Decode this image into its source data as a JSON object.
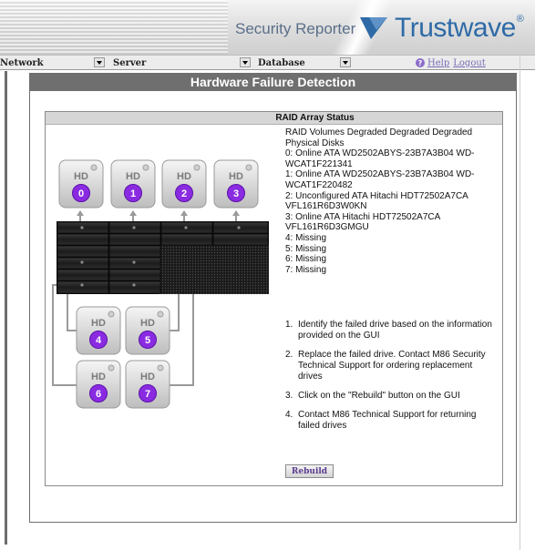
{
  "header": {
    "app_title": "Security Reporter",
    "logo_text": "Trustwave",
    "logo_mark": "®",
    "brand_color": "#2e6aa6"
  },
  "nav": {
    "network": "Network",
    "server": "Server",
    "database": "Database",
    "help": "Help",
    "logout": "Logout",
    "help_icon": "question-circle-icon"
  },
  "page": {
    "title": "Hardware Failure Detection"
  },
  "raid": {
    "panel_title": "RAID Array Status",
    "status_lines": [
      "RAID Volumes Degraded Degraded Degraded",
      "Physical Disks",
      "0: Online ATA WD2502ABYS-23B7A3B04 WD-",
      "WCAT1F221341",
      "1: Online ATA WD2502ABYS-23B7A3B04 WD-",
      "WCAT1F220482",
      "2: Unconfigured ATA Hitachi HDT72502A7CA",
      "VFL161R6D3W0KN",
      "3: Online ATA Hitachi HDT72502A7CA",
      "VFL161R6D3GMGU",
      "4: Missing",
      "5: Missing",
      "6: Missing",
      "7: Missing"
    ],
    "instructions": [
      {
        "num": "1.",
        "text": "Identify the failed drive based on the information provided on the GUI"
      },
      {
        "num": "2.",
        "text": "Replace the failed drive. Contact M86 Security Technical Support for ordering replacement drives"
      },
      {
        "num": "3.",
        "text": "Click on the \"Rebuild\" button on the GUI"
      },
      {
        "num": "4.",
        "text": "Contact M86 Technical Support for returning failed drives"
      }
    ],
    "rebuild_label": "Rebuild",
    "drive_label": "HD",
    "drives": [
      "0",
      "1",
      "2",
      "3",
      "4",
      "5",
      "6",
      "7"
    ],
    "drive_badge_color": "#8a2be2"
  }
}
